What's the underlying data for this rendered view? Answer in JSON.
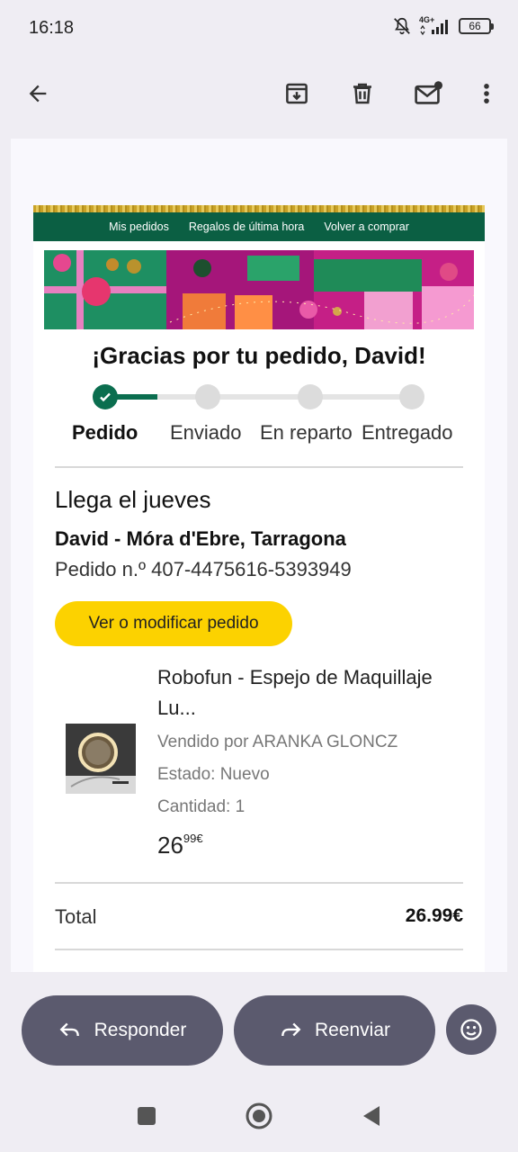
{
  "status_bar": {
    "time": "16:18",
    "network": "4G+",
    "battery": "66"
  },
  "app_bar": {
    "icons": [
      "back-arrow-icon",
      "archive-icon",
      "delete-icon",
      "mark-unread-icon",
      "more-vert-icon"
    ]
  },
  "email": {
    "nav_links": [
      "Mis pedidos",
      "Regalos de última hora",
      "Volver a comprar"
    ],
    "greeting": "¡Gracias por tu pedido, David!",
    "progress_steps": [
      {
        "label": "Pedido",
        "done": true
      },
      {
        "label": "Enviado",
        "done": false
      },
      {
        "label": "En reparto",
        "done": false
      },
      {
        "label": "Entregado",
        "done": false
      }
    ],
    "arrival": "Llega el jueves",
    "recipient": "David - Móra d'Ebre, Tarragona",
    "order_number": "Pedido n.º 407-4475616-5393949",
    "cta_label": "Ver o modificar pedido",
    "item": {
      "title_line1": "Robofun - Espejo de Maquillaje",
      "title_line2": "Lu...",
      "seller": "Vendido por ARANKA GLONCZ",
      "condition": "Estado: Nuevo",
      "quantity": "Cantidad: 1",
      "price_whole": "26",
      "price_fraction": "99€"
    },
    "total_label": "Total",
    "total_value": "26.99€"
  },
  "actions": {
    "reply_label": "Responder",
    "forward_label": "Reenviar"
  },
  "colors": {
    "accent_green": "#0b6e4f",
    "cta_yellow": "#fcd200",
    "pill_gray": "#5b5a6e"
  }
}
